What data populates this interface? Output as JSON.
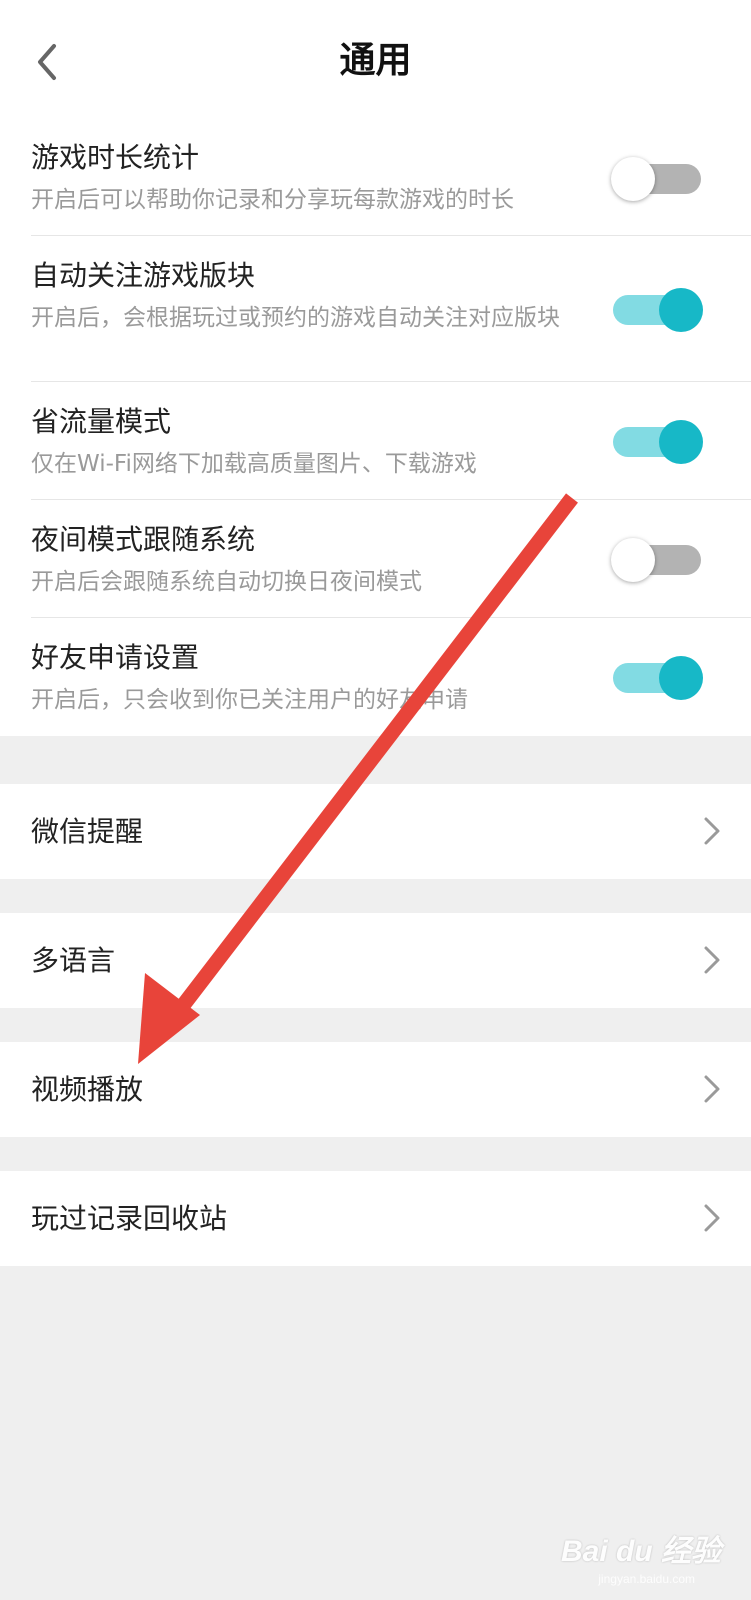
{
  "header": {
    "title": "通用",
    "back_icon": "chevron-left-icon"
  },
  "toggles": [
    {
      "title": "游戏时长统计",
      "desc": "开启后可以帮助你记录和分享玩每款游戏的时长",
      "on": false
    },
    {
      "title": "自动关注游戏版块",
      "desc": "开启后，会根据玩过或预约的游戏自动关注对应版块",
      "on": true
    },
    {
      "title": "省流量模式",
      "desc": "仅在Wi-Fi网络下加载高质量图片、下载游戏",
      "on": true
    },
    {
      "title": "夜间模式跟随系统",
      "desc": "开启后会跟随系统自动切换日夜间模式",
      "on": false
    },
    {
      "title": "好友申请设置",
      "desc": "开启后，只会收到你已关注用户的好友申请",
      "on": true
    }
  ],
  "menu": [
    {
      "label": "微信提醒"
    },
    {
      "label": "多语言"
    },
    {
      "label": "视频播放"
    },
    {
      "label": "玩过记录回收站"
    }
  ],
  "annotation": {
    "type": "red-arrow",
    "color": "#e8443a",
    "points_to": "视频播放"
  },
  "watermark": {
    "brand": "Bai du 经验",
    "sub": "jingyan.baidu.com"
  },
  "colors": {
    "accent": "#17b8c7",
    "accent_track": "#82dbe3",
    "off_track": "#b3b3b3",
    "background": "#efefef"
  }
}
